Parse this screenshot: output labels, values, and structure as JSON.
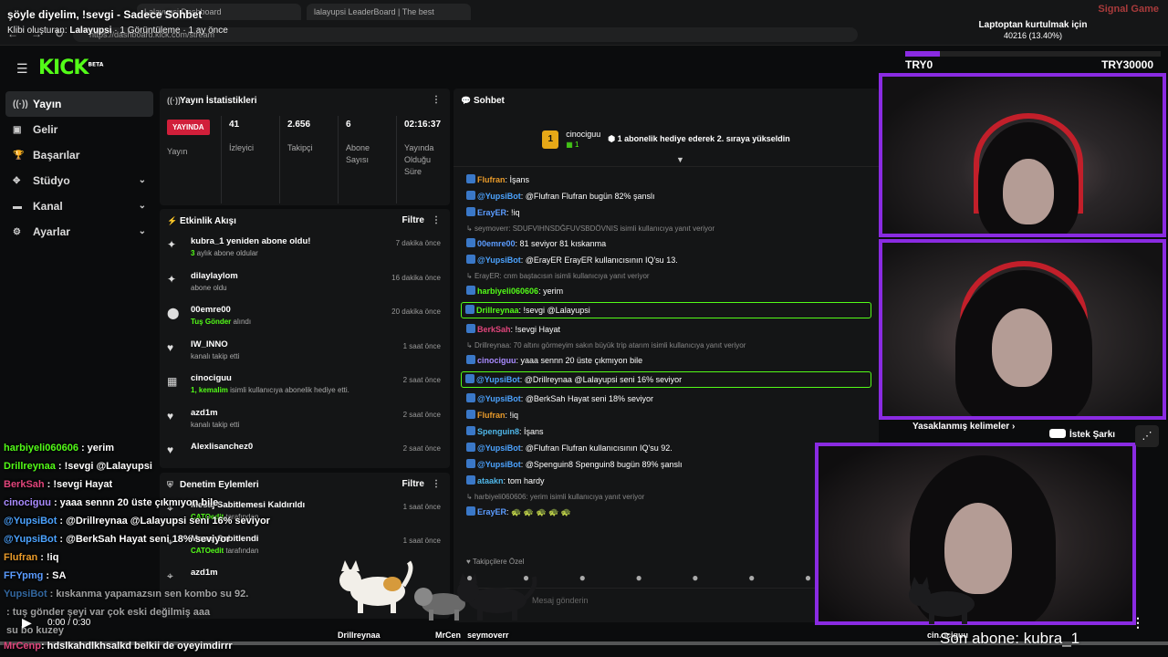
{
  "clip": {
    "title": "şöyle diyelim, !sevgi - Sadece Sohbet",
    "creator_label": "Klibi oluşturan:",
    "creator": "Lalayupsi",
    "meta": "· 1 Görüntüleme · 1 ay önce"
  },
  "browser": {
    "tabs": [
      "Lalayupsi Dashboard",
      "lalayupsi LeaderBoard | The best"
    ],
    "url": "https://dashboard.kick.com/stream"
  },
  "watermark": "Signal Game",
  "goal": {
    "title": "Laptoptan kurtulmak için",
    "amount": "40216 (13.40%)",
    "progress": 0.134,
    "min": "TRY0",
    "max": "TRY30000"
  },
  "header": {
    "logo": "KICK",
    "logo_tag": "BETA"
  },
  "sidebar": [
    {
      "label": "Yayın",
      "icon": "broadcast-icon",
      "glyph": "((·))",
      "active": true,
      "chevron": false
    },
    {
      "label": "Gelir",
      "icon": "revenue-icon",
      "glyph": "▣",
      "active": false,
      "chevron": false
    },
    {
      "label": "Başarılar",
      "icon": "trophy-icon",
      "glyph": "🏆",
      "active": false,
      "chevron": false
    },
    {
      "label": "Stüdyo",
      "icon": "studio-icon",
      "glyph": "✥",
      "active": false,
      "chevron": true
    },
    {
      "label": "Kanal",
      "icon": "channel-icon",
      "glyph": "▬",
      "active": false,
      "chevron": true
    },
    {
      "label": "Ayarlar",
      "icon": "settings-icon",
      "glyph": "⚙",
      "active": false,
      "chevron": true
    }
  ],
  "stats": {
    "title": "Yayın İstatistikleri",
    "live_badge": "YAYINDA",
    "live_label": "Yayın",
    "items": [
      {
        "value": "41",
        "label": "İzleyici"
      },
      {
        "value": "2.656",
        "label": "Takipçi"
      },
      {
        "value": "6",
        "label": "Abone Sayısı"
      },
      {
        "value": "02:16:37",
        "label": "Yayında Olduğu Süre"
      }
    ]
  },
  "activity": {
    "title": "Etkinlik Akışı",
    "filter": "Filtre",
    "items": [
      {
        "icon": "sparkle-icon",
        "glyph": "✦",
        "name": "kubra_1 yeniden abone oldu!",
        "sub_hl": "3",
        "sub": " aylık abone oldular",
        "time": "7 dakika önce"
      },
      {
        "icon": "sparkle-icon",
        "glyph": "✦",
        "name": "dilaylaylom",
        "sub_hl": "",
        "sub": "abone oldu",
        "time": "16 dakika önce"
      },
      {
        "icon": "kicks-icon",
        "glyph": "⬤",
        "name": "00emre00",
        "sub_hl": "Tuş Gönder",
        "sub": " alındı",
        "time": "20 dakika önce"
      },
      {
        "icon": "heart-icon",
        "glyph": "♥",
        "name": "IW_INNO",
        "sub_hl": "",
        "sub": "kanalı takip etti",
        "time": "1 saat önce"
      },
      {
        "icon": "gift-icon",
        "glyph": "▦",
        "name": "cinociguu",
        "sub_hl": "1, kemalim",
        "sub": " isimli kullanıcıya abonelik hediye etti.",
        "time": "2 saat önce"
      },
      {
        "icon": "heart-icon",
        "glyph": "♥",
        "name": "azd1m",
        "sub_hl": "",
        "sub": "kanalı takip etti",
        "time": "2 saat önce"
      },
      {
        "icon": "heart-icon",
        "glyph": "♥",
        "name": "Alexlisanchez0",
        "sub_hl": "",
        "sub": "",
        "time": "2 saat önce"
      }
    ]
  },
  "moderation": {
    "title": "Denetim Eylemleri",
    "filter": "Filtre",
    "items": [
      {
        "name": "Mesaj Sabitlemesi Kaldırıldı",
        "by": "CATOedit",
        "by_suffix": " tarafından",
        "time": "1 saat önce"
      },
      {
        "name": "Mesaj Sabitlendi",
        "by": "CATOedit",
        "by_suffix": " tarafından",
        "time": "1 saat önce"
      },
      {
        "name": "azd1m",
        "by": "",
        "by_suffix": "",
        "time": ""
      }
    ]
  },
  "chat": {
    "title": "Sohbet",
    "pinned": {
      "badge": "1",
      "user": "cinociguu",
      "gift_count": "1",
      "message": "1 abonelik hediye ederek 2. sıraya yükseldin"
    },
    "messages": [
      {
        "type": "msg",
        "user": "Flufran",
        "color": "c-orange",
        "text": ": İşans",
        "hl": false
      },
      {
        "type": "msg",
        "user": "@YupsiBot",
        "color": "c-bot",
        "text": ": @Flufran Flufran bugün 82% şanslı",
        "hl": false
      },
      {
        "type": "msg",
        "user": "ErayER",
        "color": "c-blue",
        "text": ": !iq",
        "hl": false
      },
      {
        "type": "reply",
        "text": "seymoverr: SDUFVIHNSDĞFUVSBDÖVNIS isimli kullanıcıya yanıt veriyor"
      },
      {
        "type": "msg",
        "user": "00emre00",
        "color": "c-blue",
        "text": ": 81 seviyor 81 kıskanma",
        "hl": false
      },
      {
        "type": "msg",
        "user": "@YupsiBot",
        "color": "c-bot",
        "text": ": @ErayER ErayER kullanıcısının IQ'su 13.",
        "hl": false
      },
      {
        "type": "reply",
        "text": "ErayER: cnm baştacısın isimli kullanıcıya yanıt veriyor"
      },
      {
        "type": "msg",
        "user": "harbiyeli060606",
        "color": "c-green",
        "text": ": yerim",
        "hl": false
      },
      {
        "type": "msg",
        "user": "Drillreynaa",
        "color": "c-green",
        "text": ": !sevgi @Lalayupsi",
        "hl": true
      },
      {
        "type": "msg",
        "user": "BerkSah",
        "color": "c-pink",
        "text": ": !sevgi Hayat",
        "hl": false
      },
      {
        "type": "reply",
        "text": "Drillreynaa: 70 altını görmeyim sakın büyük trip atarım isimli kullanıcıya yanıt veriyor"
      },
      {
        "type": "msg",
        "user": "cinociguu",
        "color": "c-purple",
        "text": ": yaaa sennn 20 üste çıkmıyon bile",
        "hl": false
      },
      {
        "type": "msg",
        "user": "@YupsiBot",
        "color": "c-bot",
        "text": ": @Drillreynaa @Lalayupsi seni 16% seviyor",
        "hl": true
      },
      {
        "type": "msg",
        "user": "@YupsiBot",
        "color": "c-bot",
        "text": ": @BerkSah Hayat seni 18% seviyor",
        "hl": false
      },
      {
        "type": "msg",
        "user": "Flufran",
        "color": "c-orange",
        "text": ": !iq",
        "hl": false
      },
      {
        "type": "msg",
        "user": "Spenguin8",
        "color": "c-teal",
        "text": ": İşans",
        "hl": false
      },
      {
        "type": "msg",
        "user": "@YupsiBot",
        "color": "c-bot",
        "text": ": @Flufran Flufran kullanıcısının IQ'su 92.",
        "hl": false
      },
      {
        "type": "msg",
        "user": "@YupsiBot",
        "color": "c-bot",
        "text": ": @Spenguin8 Spenguin8 bugün 89% şanslı",
        "hl": false
      },
      {
        "type": "msg",
        "user": "ataakn",
        "color": "c-teal",
        "text": ": tom hardy",
        "hl": false
      },
      {
        "type": "reply",
        "text": "harbiyeli060606: yerim isimli kullanıcıya yanıt veriyor"
      },
      {
        "type": "msg",
        "user": "ErayER",
        "color": "c-blue",
        "text": ": 🐢 🐢 🐢 🐢 🐢",
        "hl": false
      }
    ],
    "followers_only": "Takipçilere Özel",
    "input_placeholder": "Mesaj gönderin"
  },
  "overlay_chat": [
    {
      "user": "harbiyeli060606",
      "color": "#53fc18",
      "text": ": yerim"
    },
    {
      "user": "Drillreynaa",
      "color": "#53fc18",
      "text": ": !sevgi @Lalayupsi"
    },
    {
      "user": "BerkSah",
      "color": "#e0457b",
      "text": ": !sevgi Hayat"
    },
    {
      "user": "cinociguu",
      "color": "#a98bff",
      "text": ": yaaa sennn 20 üste çıkmıyon bile"
    },
    {
      "user": "@YupsiBot",
      "color": "#4ca3ff",
      "text": ": @Drillreynaa @Lalayupsi seni 16% seviyor"
    },
    {
      "user": "@YupsiBot",
      "color": "#4ca3ff",
      "text": ": @BerkSah Hayat seni 18% seviyor"
    },
    {
      "user": "Flufran",
      "color": "#e89a2a",
      "text": ": !iq"
    },
    {
      "user": "FFYpmg",
      "color": "#5b9cff",
      "text": ": SA"
    },
    {
      "user": "YupsiBot",
      "color": "#4ca3ff",
      "text": ": kıskanma yapamazsın sen kombo su 92."
    },
    {
      "user": "",
      "color": "#fff",
      "text": ": tuş gönder şeyi var çok eski değilmiş aaa"
    },
    {
      "user": "",
      "color": "#fff",
      "text": "su bo kuzey"
    }
  ],
  "bottom_msg": {
    "user": "MrCenp",
    "color": "#e0457b",
    "text": ": hdslkahdlkhsalkd belkii de oyeyimdirrr"
  },
  "pets": [
    {
      "label": "Drillreynaa"
    },
    {
      "label": "MrCen"
    },
    {
      "label": "seymoverr"
    },
    {
      "label": "cin.ociguu"
    }
  ],
  "widgets": {
    "banned_words": "Yasaklanmış kelimeler",
    "song_request": "İstek Şarkı"
  },
  "video": {
    "time": "0:00 / 0:30",
    "progress": 0.0
  },
  "last_sub": "Son abone: kubra_1"
}
